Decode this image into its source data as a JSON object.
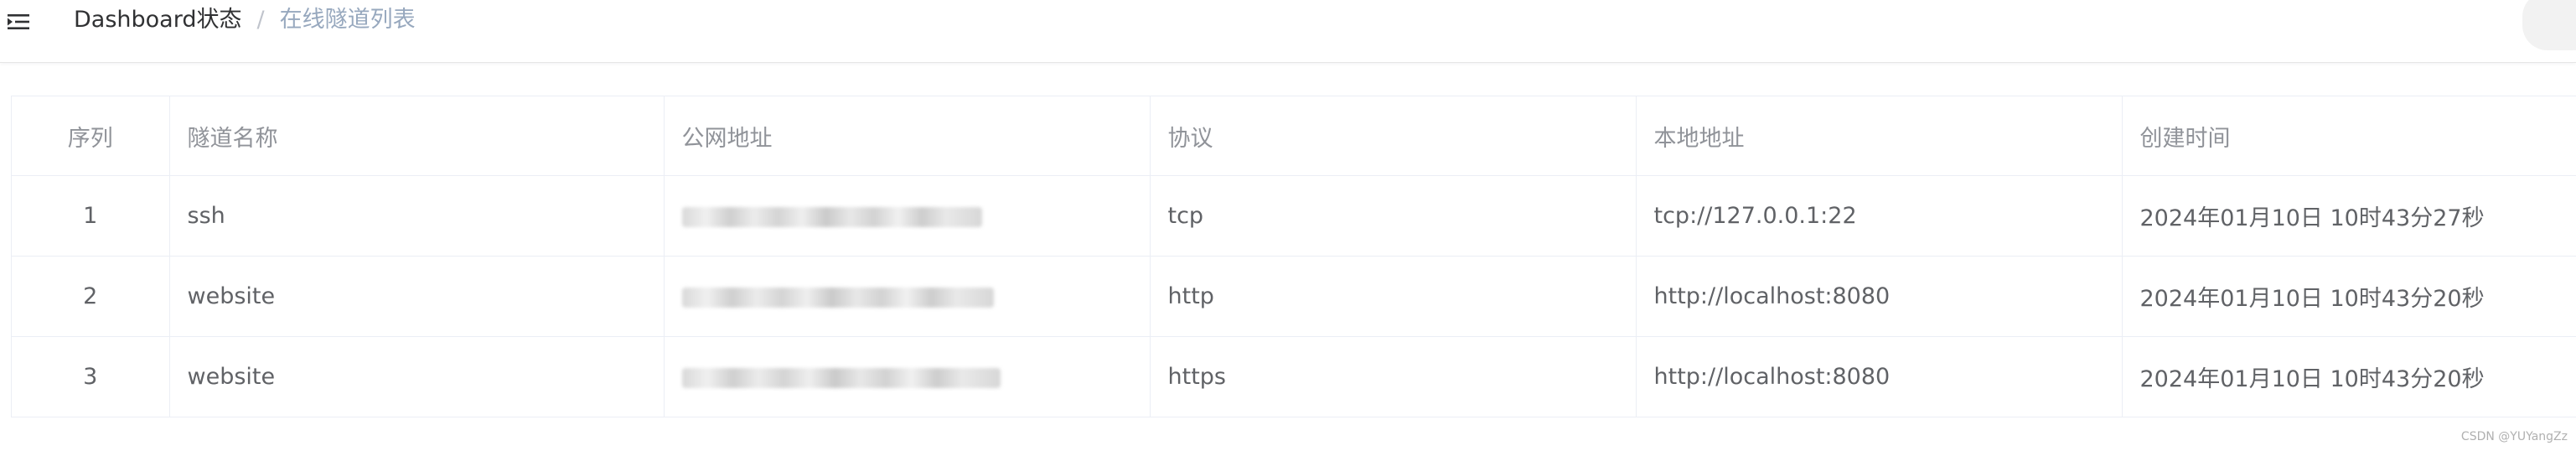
{
  "header": {
    "menu_icon": "menu-fold-icon",
    "breadcrumb": {
      "home": "Dashboard状态",
      "separator": "/",
      "current": "在线隧道列表"
    }
  },
  "table": {
    "columns": [
      "序列",
      "隧道名称",
      "公网地址",
      "协议",
      "本地地址",
      "创建时间"
    ],
    "rows": [
      {
        "index": "1",
        "name": "ssh",
        "public_address": "",
        "protocol": "tcp",
        "local_address": "tcp://127.0.0.1:22",
        "created": "2024年01月10日 10时43分27秒"
      },
      {
        "index": "2",
        "name": "website",
        "public_address": "",
        "protocol": "http",
        "local_address": "http://localhost:8080",
        "created": "2024年01月10日 10时43分20秒"
      },
      {
        "index": "3",
        "name": "website",
        "public_address": "",
        "protocol": "https",
        "local_address": "http://localhost:8080",
        "created": "2024年01月10日 10时43分20秒"
      }
    ]
  },
  "watermark": "CSDN @YUYangZz"
}
